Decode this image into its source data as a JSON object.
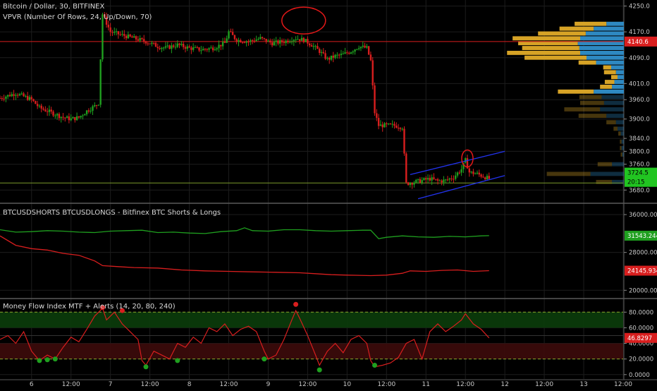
{
  "chart_data": [
    {
      "type": "candlestick",
      "title": "Bitcoin / Dollar, 30, BITFINEX",
      "indicator_label": "VPVR (Number Of Rows, 24, Up/Down, 70)",
      "ylim": [
        3650,
        4260
      ],
      "y_ticks": [
        "4250.0",
        "4170.0",
        "4090.0",
        "4010.0",
        "3960.0",
        "3900.0",
        "3840.0",
        "3800.0",
        "3760.0",
        "3680.0"
      ],
      "y_tick_values": [
        4250,
        4170,
        4090,
        4010,
        3960,
        3900,
        3840,
        3800,
        3760,
        3680
      ],
      "price_tag_red": {
        "value": 4140.0,
        "label": "4140.6",
        "color": "#d81e1e"
      },
      "price_tag_green": {
        "value": 3734,
        "label": "3724.5",
        "color": "#21c521"
      },
      "countdown_tag": {
        "value": 3714,
        "label": "20:15",
        "color": "#21c521"
      },
      "horizontal_line_red": 4140,
      "horizontal_line_green": 3702,
      "price_path": [
        [
          0,
          3965
        ],
        [
          4,
          3980
        ],
        [
          8,
          3960
        ],
        [
          10,
          3935
        ],
        [
          12,
          3925
        ],
        [
          14,
          3915
        ],
        [
          16,
          3905
        ],
        [
          18,
          3900
        ],
        [
          20,
          3905
        ],
        [
          22,
          3925
        ],
        [
          24,
          3940
        ],
        [
          25,
          3950
        ],
        [
          26,
          4225
        ],
        [
          28,
          4170
        ],
        [
          31,
          4160
        ],
        [
          34,
          4150
        ],
        [
          37,
          4140
        ],
        [
          40,
          4125
        ],
        [
          42,
          4120
        ],
        [
          45,
          4130
        ],
        [
          48,
          4120
        ],
        [
          51,
          4115
        ],
        [
          54,
          4120
        ],
        [
          57,
          4135
        ],
        [
          58,
          4170
        ],
        [
          60,
          4145
        ],
        [
          63,
          4140
        ],
        [
          66,
          4150
        ],
        [
          69,
          4135
        ],
        [
          72,
          4140
        ],
        [
          75,
          4150
        ],
        [
          77,
          4145
        ],
        [
          79,
          4130
        ],
        [
          81,
          4110
        ],
        [
          83,
          4085
        ],
        [
          85,
          4095
        ],
        [
          87,
          4100
        ],
        [
          89,
          4110
        ],
        [
          91,
          4125
        ],
        [
          93,
          4120
        ],
        [
          94,
          4080
        ],
        [
          95,
          3920
        ],
        [
          96,
          3880
        ],
        [
          98,
          3880
        ],
        [
          100,
          3880
        ],
        [
          102,
          3875
        ],
        [
          103,
          3700
        ],
        [
          105,
          3705
        ],
        [
          107,
          3710
        ],
        [
          109,
          3715
        ],
        [
          111,
          3708
        ],
        [
          113,
          3710
        ],
        [
          115,
          3720
        ],
        [
          117,
          3745
        ],
        [
          118,
          3772
        ],
        [
          119,
          3735
        ],
        [
          121,
          3730
        ],
        [
          123,
          3720
        ],
        [
          124,
          3715
        ]
      ],
      "vpvr_bins": [
        {
          "price": 4195,
          "up": 0.4,
          "down": 0.22,
          "level": "value_area"
        },
        {
          "price": 4180,
          "up": 0.43,
          "down": 0.38,
          "level": "value_area"
        },
        {
          "price": 4165,
          "up": 0.6,
          "down": 0.48,
          "level": "value_area"
        },
        {
          "price": 4150,
          "up": 0.85,
          "down": 0.55,
          "level": "value_area"
        },
        {
          "price": 4135,
          "up": 0.75,
          "down": 0.58,
          "level": "value_area"
        },
        {
          "price": 4120,
          "up": 0.72,
          "down": 0.56,
          "level": "value_area"
        },
        {
          "price": 4105,
          "up": 0.92,
          "down": 0.55,
          "level": "value_area"
        },
        {
          "price": 4090,
          "up": 0.78,
          "down": 0.47,
          "level": "value_area"
        },
        {
          "price": 4075,
          "up": 0.22,
          "down": 0.35,
          "level": "value_area"
        },
        {
          "price": 4060,
          "up": 0.1,
          "down": 0.16,
          "level": "value_area"
        },
        {
          "price": 4045,
          "up": 0.15,
          "down": 0.1,
          "level": "value_area"
        },
        {
          "price": 4030,
          "up": 0.08,
          "down": 0.08,
          "level": "value_area"
        },
        {
          "price": 4015,
          "up": 0.12,
          "down": 0.12,
          "level": "value_area"
        },
        {
          "price": 4000,
          "up": 0.15,
          "down": 0.15,
          "level": "value_area"
        },
        {
          "price": 3985,
          "up": 0.45,
          "down": 0.38,
          "level": "value_area"
        },
        {
          "price": 3968,
          "up": 0.28,
          "down": 0.28,
          "level": "outside"
        },
        {
          "price": 3950,
          "up": 0.3,
          "down": 0.25,
          "level": "outside"
        },
        {
          "price": 3930,
          "up": 0.45,
          "down": 0.3,
          "level": "outside"
        },
        {
          "price": 3910,
          "up": 0.35,
          "down": 0.22,
          "level": "outside"
        },
        {
          "price": 3890,
          "up": 0.12,
          "down": 0.1,
          "level": "outside"
        },
        {
          "price": 3870,
          "up": 0.05,
          "down": 0.08,
          "level": "outside"
        },
        {
          "price": 3855,
          "up": 0.03,
          "down": 0.04,
          "level": "outside"
        },
        {
          "price": 3830,
          "up": 0.02,
          "down": 0.03,
          "level": "outside"
        },
        {
          "price": 3810,
          "up": 0.02,
          "down": 0.03,
          "level": "outside"
        },
        {
          "price": 3790,
          "up": 0.02,
          "down": 0.02,
          "level": "outside"
        },
        {
          "price": 3760,
          "up": 0.18,
          "down": 0.15,
          "level": "outside"
        },
        {
          "price": 3730,
          "up": 0.55,
          "down": 0.42,
          "level": "outside"
        },
        {
          "price": 3705,
          "up": 0.2,
          "down": 0.15,
          "level": "outside"
        }
      ],
      "annotations": {
        "ellipse_top": {
          "center_x": 77,
          "center_value": 4205
        },
        "ellipse_bottom": {
          "center_x": 118.5,
          "center_value": 3778
        },
        "channel_upper": [
          [
            104,
            3728
          ],
          [
            128,
            3800
          ]
        ],
        "channel_lower": [
          [
            106,
            3653
          ],
          [
            128,
            3725
          ]
        ]
      }
    },
    {
      "type": "line",
      "title": "BTCUSDSHORTS BTCUSDLONGS - Bitfinex BTC Shorts & Longs",
      "ylim": [
        19000,
        37500
      ],
      "y_ticks": [
        "36000.0000",
        "28000.0000",
        "20000.0000"
      ],
      "y_tick_values": [
        36000,
        28000,
        20000
      ],
      "series": [
        {
          "name": "BTCUSDLONGS",
          "color": "#1f9f1f",
          "label": "31543.2448",
          "points": [
            [
              0,
              32800
            ],
            [
              4,
              32300
            ],
            [
              8,
              32400
            ],
            [
              12,
              32600
            ],
            [
              16,
              32500
            ],
            [
              20,
              32300
            ],
            [
              24,
              32200
            ],
            [
              28,
              32500
            ],
            [
              32,
              32600
            ],
            [
              36,
              32700
            ],
            [
              40,
              32200
            ],
            [
              44,
              32300
            ],
            [
              48,
              32100
            ],
            [
              52,
              32000
            ],
            [
              56,
              32400
            ],
            [
              60,
              32600
            ],
            [
              62,
              33200
            ],
            [
              64,
              32600
            ],
            [
              68,
              32500
            ],
            [
              72,
              32800
            ],
            [
              76,
              32800
            ],
            [
              80,
              32600
            ],
            [
              84,
              32500
            ],
            [
              88,
              32600
            ],
            [
              92,
              32700
            ],
            [
              94,
              32700
            ],
            [
              96,
              30900
            ],
            [
              98,
              31200
            ],
            [
              102,
              31500
            ],
            [
              106,
              31300
            ],
            [
              110,
              31200
            ],
            [
              114,
              31400
            ],
            [
              118,
              31300
            ],
            [
              122,
              31500
            ],
            [
              124,
              31543
            ]
          ]
        },
        {
          "name": "BTCUSDSHORTS",
          "color": "#d81e1e",
          "label": "24145.9348",
          "points": [
            [
              0,
              31500
            ],
            [
              4,
              29500
            ],
            [
              8,
              28800
            ],
            [
              12,
              28500
            ],
            [
              16,
              27800
            ],
            [
              20,
              27400
            ],
            [
              24,
              26200
            ],
            [
              26,
              25200
            ],
            [
              30,
              25000
            ],
            [
              34,
              24800
            ],
            [
              40,
              24700
            ],
            [
              46,
              24300
            ],
            [
              52,
              24100
            ],
            [
              58,
              24000
            ],
            [
              64,
              23900
            ],
            [
              70,
              23800
            ],
            [
              76,
              23700
            ],
            [
              80,
              23500
            ],
            [
              84,
              23300
            ],
            [
              88,
              23200
            ],
            [
              94,
              23100
            ],
            [
              98,
              23200
            ],
            [
              102,
              23600
            ],
            [
              104,
              24100
            ],
            [
              108,
              24000
            ],
            [
              112,
              24200
            ],
            [
              116,
              24300
            ],
            [
              120,
              24000
            ],
            [
              124,
              24146
            ]
          ]
        }
      ]
    },
    {
      "type": "line",
      "title": "Money Flow Index MTF + Alerts (14, 20, 80, 240)",
      "ylim": [
        -2,
        92
      ],
      "y_ticks": [
        "80.0000",
        "60.0000",
        "40.0000",
        "20.0000",
        "0.0000"
      ],
      "y_tick_values": [
        80,
        60,
        40,
        20,
        0
      ],
      "upper_band": 80,
      "lower_band": 20,
      "value_label": "46.8297",
      "series": [
        {
          "name": "MFI",
          "color": "#d81e1e",
          "points": [
            [
              0,
              45
            ],
            [
              2,
              50
            ],
            [
              4,
              40
            ],
            [
              6,
              55
            ],
            [
              8,
              30
            ],
            [
              10,
              18
            ],
            [
              12,
              25
            ],
            [
              14,
              20
            ],
            [
              16,
              35
            ],
            [
              18,
              48
            ],
            [
              20,
              42
            ],
            [
              22,
              58
            ],
            [
              24,
              75
            ],
            [
              26,
              85
            ],
            [
              27,
              70
            ],
            [
              29,
              80
            ],
            [
              31,
              65
            ],
            [
              33,
              55
            ],
            [
              35,
              45
            ],
            [
              36,
              18
            ],
            [
              37,
              12
            ],
            [
              39,
              30
            ],
            [
              41,
              25
            ],
            [
              43,
              20
            ],
            [
              45,
              40
            ],
            [
              47,
              35
            ],
            [
              49,
              48
            ],
            [
              51,
              40
            ],
            [
              53,
              60
            ],
            [
              55,
              55
            ],
            [
              57,
              65
            ],
            [
              59,
              50
            ],
            [
              61,
              58
            ],
            [
              63,
              62
            ],
            [
              65,
              55
            ],
            [
              67,
              30
            ],
            [
              68,
              20
            ],
            [
              70,
              25
            ],
            [
              72,
              45
            ],
            [
              74,
              70
            ],
            [
              75,
              82
            ],
            [
              76,
              72
            ],
            [
              78,
              50
            ],
            [
              80,
              25
            ],
            [
              81,
              12
            ],
            [
              83,
              30
            ],
            [
              85,
              40
            ],
            [
              87,
              28
            ],
            [
              89,
              45
            ],
            [
              91,
              50
            ],
            [
              93,
              40
            ],
            [
              94,
              18
            ],
            [
              95,
              10
            ],
            [
              97,
              12
            ],
            [
              99,
              15
            ],
            [
              101,
              22
            ],
            [
              103,
              40
            ],
            [
              105,
              45
            ],
            [
              107,
              20
            ],
            [
              109,
              55
            ],
            [
              111,
              65
            ],
            [
              113,
              55
            ],
            [
              115,
              62
            ],
            [
              117,
              70
            ],
            [
              118,
              78
            ],
            [
              120,
              65
            ],
            [
              122,
              58
            ],
            [
              124,
              47
            ]
          ]
        }
      ],
      "markers": [
        {
          "x": 10,
          "value": 18,
          "color": "#1f9f1f"
        },
        {
          "x": 12,
          "value": 19,
          "color": "#1f9f1f"
        },
        {
          "x": 14,
          "value": 20,
          "color": "#1f9f1f"
        },
        {
          "x": 26,
          "value": 86,
          "color": "#d81e1e"
        },
        {
          "x": 31,
          "value": 82,
          "color": "#d81e1e"
        },
        {
          "x": 37,
          "value": 10,
          "color": "#1f9f1f"
        },
        {
          "x": 45,
          "value": 18,
          "color": "#1f9f1f"
        },
        {
          "x": 67,
          "value": 20,
          "color": "#1f9f1f"
        },
        {
          "x": 75,
          "value": 90,
          "color": "#d81e1e"
        },
        {
          "x": 81,
          "value": 6,
          "color": "#1f9f1f"
        },
        {
          "x": 95,
          "value": 12,
          "color": "#1f9f1f"
        }
      ]
    }
  ],
  "x_axis": {
    "labels": [
      "6",
      "12:00",
      "7",
      "12:00",
      "8",
      "12:00",
      "9",
      "12:00",
      "10",
      "12:00",
      "11",
      "12:00",
      "12",
      "12:00",
      "13",
      "12:00"
    ],
    "positions": [
      8,
      18,
      28,
      38,
      48,
      58,
      68,
      78,
      88,
      98,
      108,
      118,
      128,
      138,
      148,
      158
    ],
    "range": [
      0,
      158
    ]
  },
  "colors": {
    "background": "#000000",
    "grid": "#1d1d1d",
    "up": "#1f9f1f",
    "down": "#d81e1e",
    "vpvr_up": "#d7a326",
    "vpvr_down": "#2e89c2",
    "channel": "#2233ee",
    "divider": "#5a5a5a",
    "text": "#d8d8d8"
  }
}
